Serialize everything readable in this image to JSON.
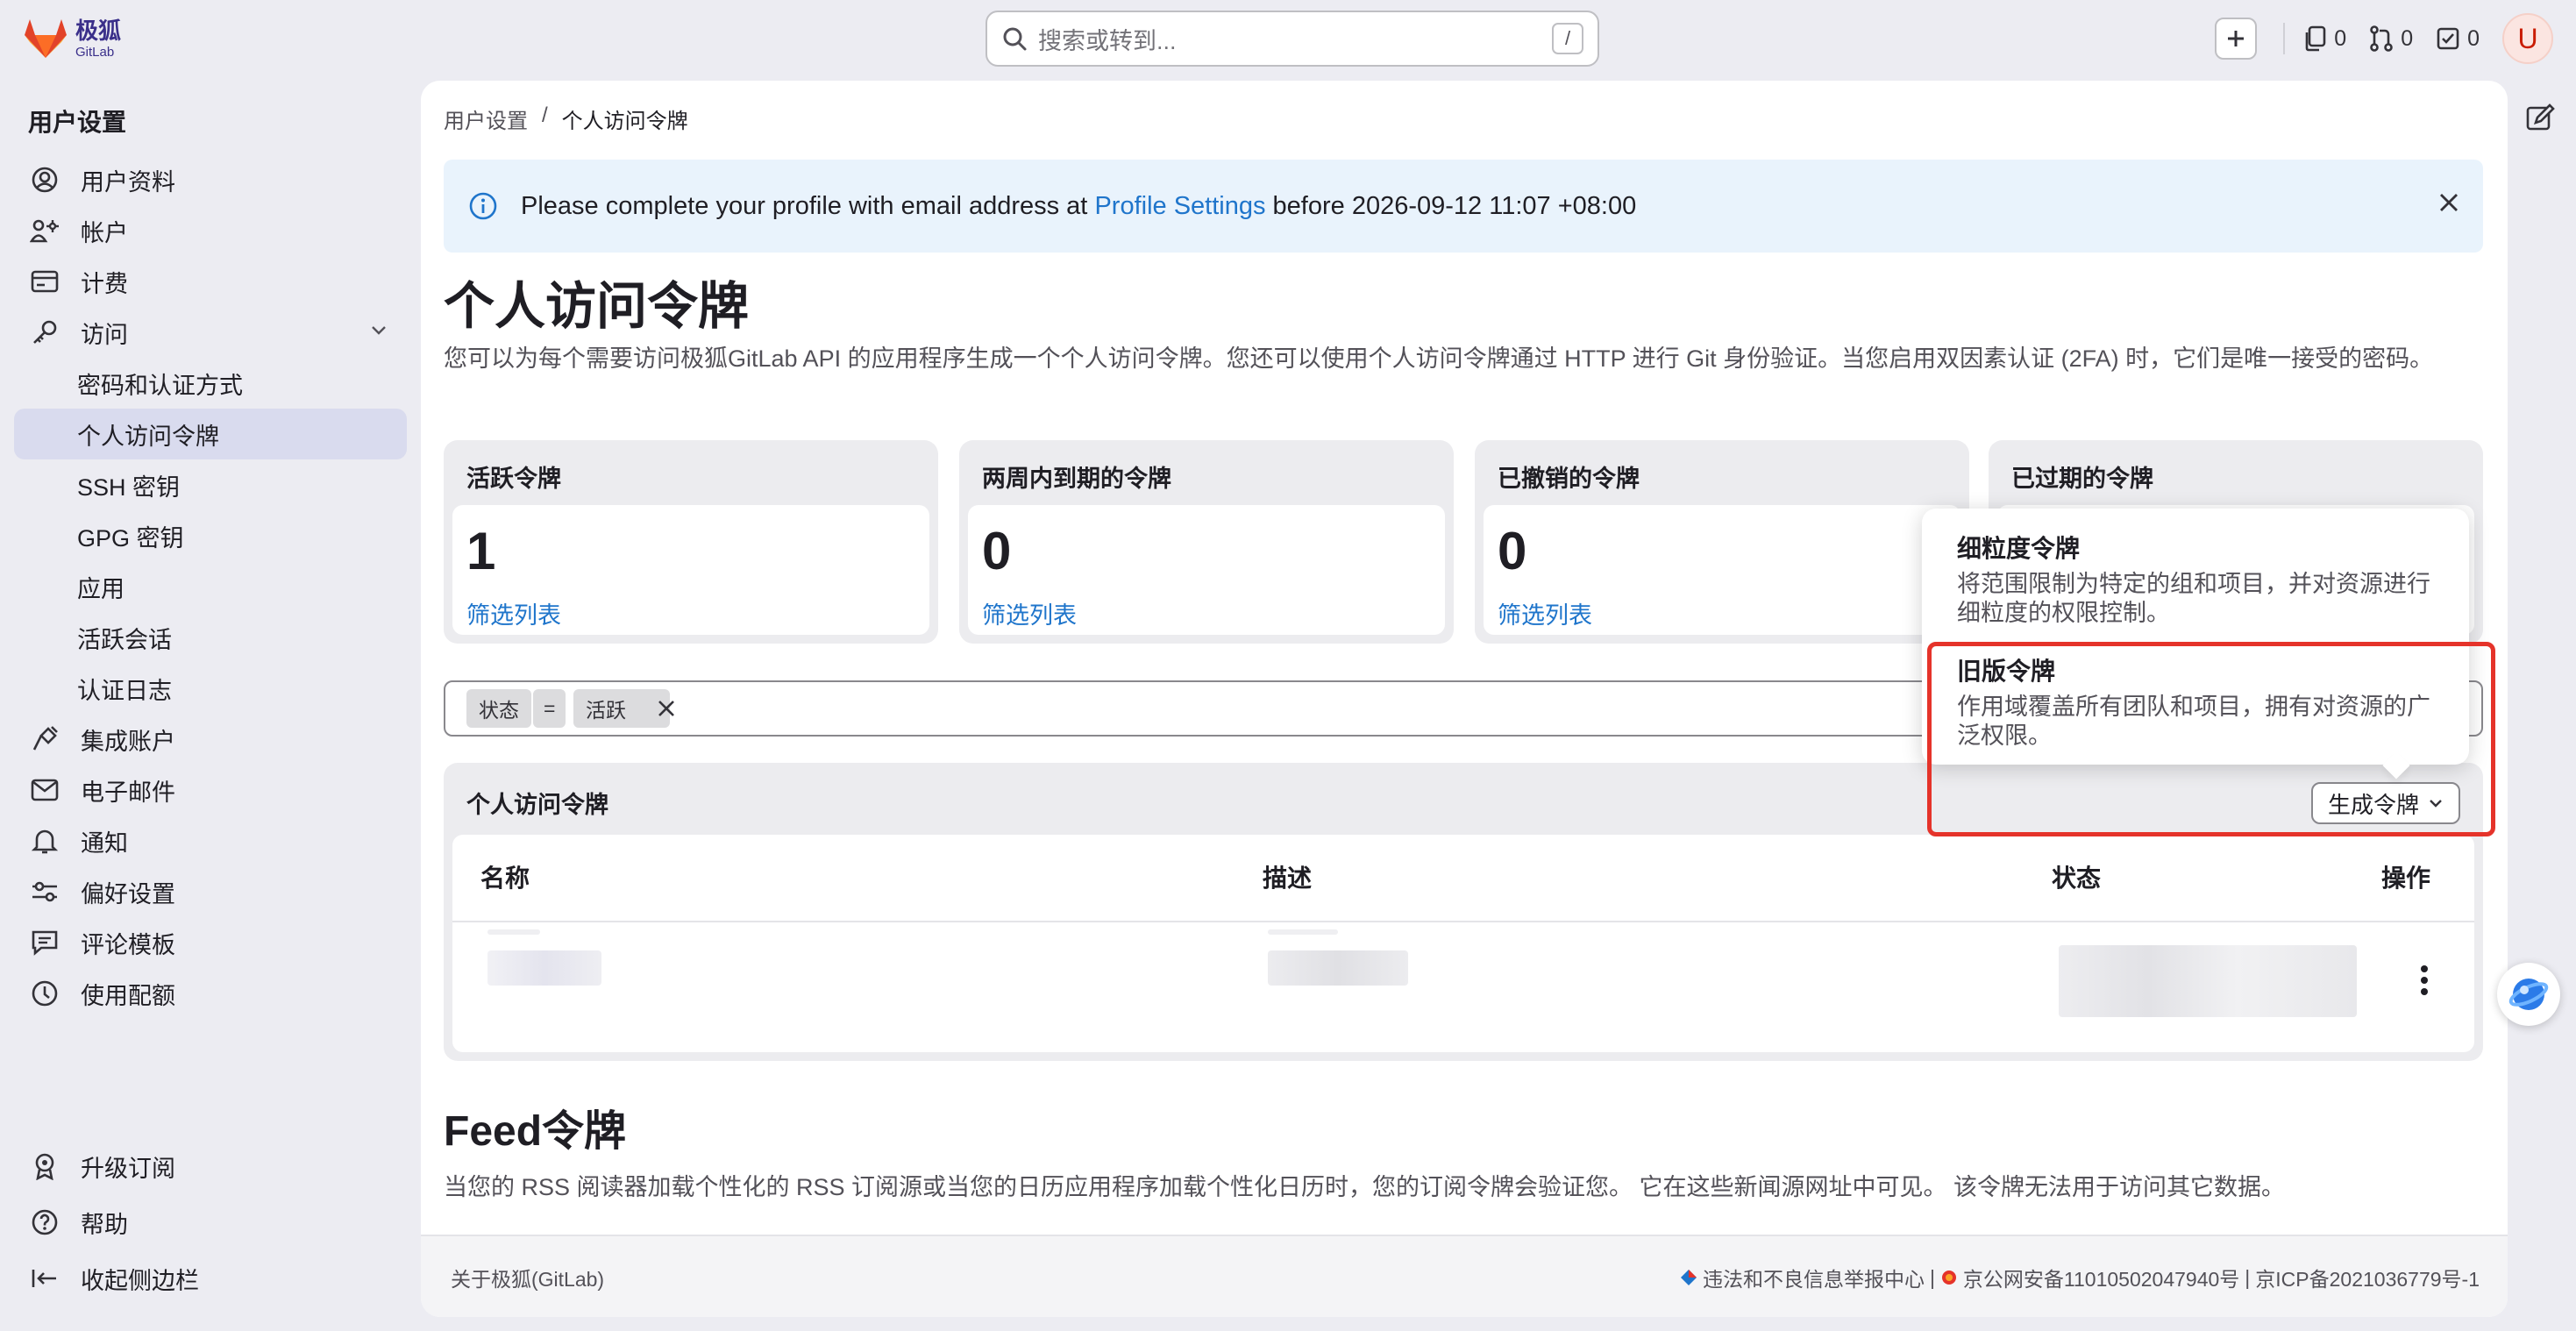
{
  "brand": {
    "name": "极狐",
    "sub": "GitLab"
  },
  "search": {
    "placeholder": "搜索或转到...",
    "shortcut": "/"
  },
  "topbar": {
    "issues_count": "0",
    "mr_count": "0",
    "todo_count": "0",
    "avatar_letter": "U"
  },
  "sidebar": {
    "title": "用户设置",
    "items": [
      {
        "label": "用户资料",
        "icon": "profile-icon"
      },
      {
        "label": "帐户",
        "icon": "account-icon"
      },
      {
        "label": "计费",
        "icon": "billing-icon"
      },
      {
        "label": "访问",
        "icon": "key-icon"
      },
      {
        "label": "密码和认证方式"
      },
      {
        "label": "个人访问令牌"
      },
      {
        "label": "SSH 密钥"
      },
      {
        "label": "GPG 密钥"
      },
      {
        "label": "应用"
      },
      {
        "label": "活跃会话"
      },
      {
        "label": "认证日志"
      },
      {
        "label": "集成账户",
        "icon": "integration-icon"
      },
      {
        "label": "电子邮件",
        "icon": "mail-icon"
      },
      {
        "label": "通知",
        "icon": "bell-icon"
      },
      {
        "label": "偏好设置",
        "icon": "preferences-icon"
      },
      {
        "label": "评论模板",
        "icon": "comment-template-icon"
      },
      {
        "label": "使用配额",
        "icon": "quota-icon"
      }
    ],
    "bottom": [
      {
        "label": "升级订阅"
      },
      {
        "label": "帮助"
      },
      {
        "label": "收起侧边栏"
      }
    ]
  },
  "breadcrumb": {
    "parent": "用户设置",
    "sep": "/",
    "current": "个人访问令牌"
  },
  "alert": {
    "before": "Please complete your profile with email address at ",
    "link": "Profile Settings",
    "after": " before 2026-09-12 11:07 +08:00"
  },
  "page": {
    "title": "个人访问令牌",
    "description": "您可以为每个需要访问极狐GitLab API 的应用程序生成一个个人访问令牌。您还可以使用个人访问令牌通过 HTTP 进行 Git 身份验证。当您启用双因素认证 (2FA) 时，它们是唯一接受的密码。"
  },
  "stats": [
    {
      "title": "活跃令牌",
      "value": "1",
      "link": "筛选列表"
    },
    {
      "title": "两周内到期的令牌",
      "value": "0",
      "link": "筛选列表"
    },
    {
      "title": "已撤销的令牌",
      "value": "0",
      "link": "筛选列表"
    },
    {
      "title": "已过期的令牌"
    }
  ],
  "filter": {
    "key": "状态",
    "op": "=",
    "value": "活跃"
  },
  "table": {
    "title": "个人访问令牌",
    "generate_button": "生成令牌",
    "columns": [
      "名称",
      "描述",
      "状态",
      "操作"
    ]
  },
  "dropdown": {
    "items": [
      {
        "title": "细粒度令牌",
        "desc": "将范围限制为特定的组和项目，并对资源进行细粒度的权限控制。"
      },
      {
        "title": "旧版令牌",
        "desc": "作用域覆盖所有团队和项目，拥有对资源的广泛权限。"
      }
    ]
  },
  "feed": {
    "title": "Feed令牌",
    "description": "当您的 RSS 阅读器加载个性化的 RSS 订阅源或当您的日历应用程序加载个性化日历时，您的订阅令牌会验证您。 它在这些新闻源网址中可见。 该令牌无法用于访问其它数据。"
  },
  "footer": {
    "left": "关于极狐(GitLab)",
    "report": "违法和不良信息举报中心",
    "sep": "|",
    "police": "京公网安备11010502047940号",
    "icp": "京ICP备2021036779号-1"
  },
  "colors": {
    "accent": "#1f75cb",
    "highlight": "#e5332a",
    "active_nav": "#d9dbee"
  }
}
